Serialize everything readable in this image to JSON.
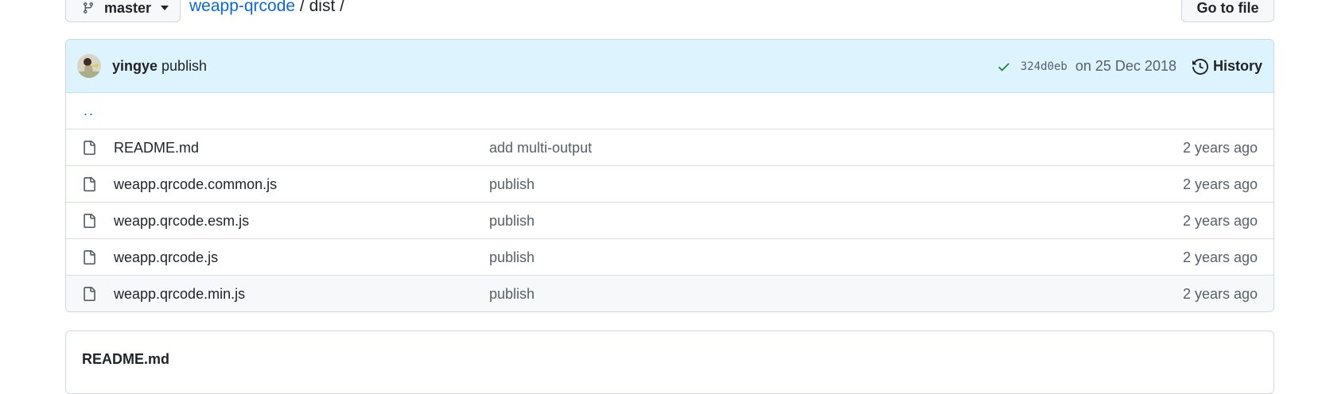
{
  "branch": {
    "name": "master"
  },
  "breadcrumb": {
    "repo": "weapp-qrcode",
    "sep1": " / ",
    "dir": "dist",
    "sep2": " /"
  },
  "goto_file": {
    "label": "Go to file"
  },
  "commit": {
    "author": "yingye",
    "message": "publish",
    "sha": "324d0eb",
    "date": "on 25 Dec 2018",
    "history_label": "History"
  },
  "parent_dir": "..",
  "files": [
    {
      "name": "README.md",
      "message": "add multi-output",
      "age": "2 years ago"
    },
    {
      "name": "weapp.qrcode.common.js",
      "message": "publish",
      "age": "2 years ago"
    },
    {
      "name": "weapp.qrcode.esm.js",
      "message": "publish",
      "age": "2 years ago"
    },
    {
      "name": "weapp.qrcode.js",
      "message": "publish",
      "age": "2 years ago"
    },
    {
      "name": "weapp.qrcode.min.js",
      "message": "publish",
      "age": "2 years ago"
    }
  ],
  "readme": {
    "title": "README.md"
  },
  "icons": {
    "branch": "git-branch-icon",
    "file": "file-icon",
    "check": "check-icon",
    "history": "history-icon"
  },
  "colors": {
    "link": "#0969da",
    "commit_bg": "#ddf4ff",
    "success": "#1a7f37",
    "muted": "#57606a"
  }
}
